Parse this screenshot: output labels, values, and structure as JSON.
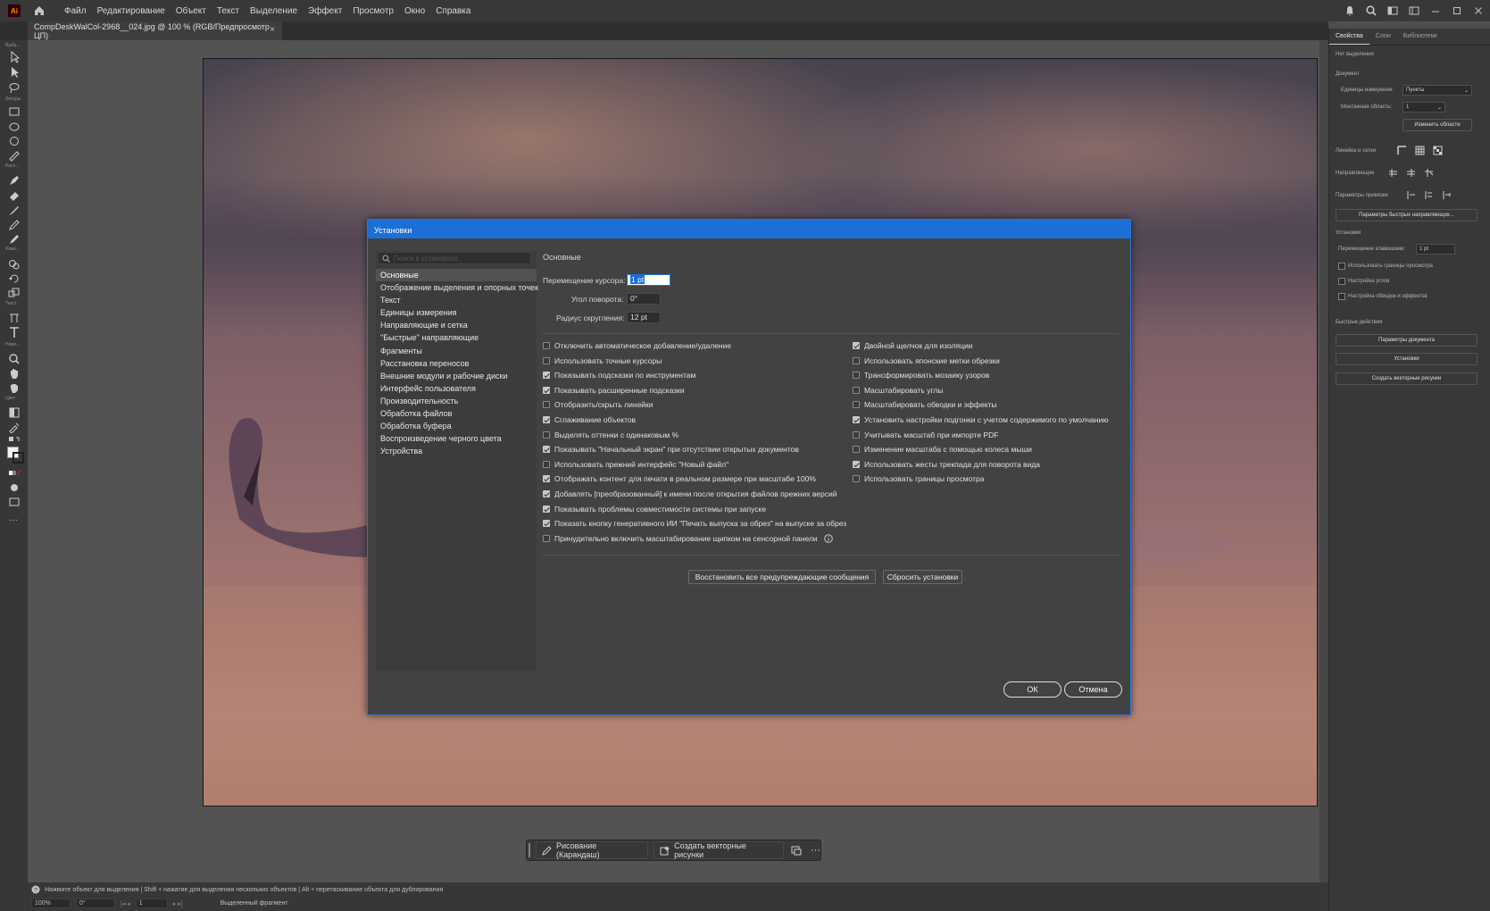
{
  "app": {
    "logo_text": "Ai",
    "menu": [
      "Файл",
      "Редактирование",
      "Объект",
      "Текст",
      "Выделение",
      "Эффект",
      "Просмотр",
      "Окно",
      "Справка"
    ]
  },
  "document_tab": {
    "title": "CompDeskWalCol-2968__024.jpg @ 100 % (RGB/Предпросмотр ЦП)",
    "close": "×"
  },
  "toolbar_labels": [
    "Выбр...",
    "Фигуры",
    "Рисо...",
    "Изме...",
    "Текст",
    "Нави...",
    "Цвет"
  ],
  "floating_bar": {
    "draw_label": "Рисование (Карандаш)",
    "vectorize_label": "Создать векторные рисунки",
    "more": "···"
  },
  "status": {
    "hint": "Нажмите объект для выделения | Shift + нажатие для выделения нескольких объектов | Alt + перетаскивание объекта для дублирования",
    "zoom": "100%",
    "rotation": "0°",
    "artboard_num": "1",
    "mode": "Выделенный фрагмент"
  },
  "right_panel": {
    "tabs": [
      "Свойства",
      "Слои",
      "Библиотеки"
    ],
    "no_selection": "Нет выделения",
    "document_label": "Документ",
    "units_label": "Единицы измерения:",
    "units_value": "Пункты",
    "artboard_label": "Монтажная область:",
    "artboard_value": "1",
    "edit_artboards": "Изменить области",
    "rulers_grids": "Линейка и сетки",
    "guides": "Направляющие",
    "snap_options": "Параметры привязки",
    "smart_guides_btn": "Параметры быстрых направляющих...",
    "prefs_label": "Установки",
    "keyboard_increment_label": "Перемещение клавишами:",
    "keyboard_increment_value": "1 pt",
    "check_preview_bounds": "Использовать границы просмотра",
    "check_corners": "Настройка углов",
    "check_strokes": "Настройка обводок и эффектов",
    "quick_actions": "Быстрые действия",
    "doc_setup_btn": "Параметры документа",
    "prefs_btn": "Установки",
    "vectorize_btn": "Создать векторные рисунки"
  },
  "dialog": {
    "title": "Установки",
    "search_placeholder": "Поиск в установках",
    "nav": [
      "Основные",
      "Отображение выделения и опорных точек",
      "Текст",
      "Единицы измерения",
      "Направляющие и сетка",
      "\"Быстрые\" направляющие",
      "Фрагменты",
      "Расстановка переносов",
      "Внешние модули и рабочие диски",
      "Интерфейс пользователя",
      "Производительность",
      "Обработка файлов",
      "Обработка буфера",
      "Воспроизведение черного цвета",
      "Устройства"
    ],
    "section_title": "Основные",
    "keyboard_increment_label": "Перемещение курсора:",
    "keyboard_increment_value": "1 pt",
    "constrain_angle_label": "Угол поворота:",
    "constrain_angle_value": "0°",
    "corner_radius_label": "Радиус скругления:",
    "corner_radius_value": "12 pt",
    "left_checks": [
      {
        "label": "Отключить автоматическое добавление/удаление",
        "checked": false
      },
      {
        "label": "Использовать точные курсоры",
        "checked": false
      },
      {
        "label": "Показывать подсказки по инструментам",
        "checked": true
      },
      {
        "label": "Показывать расширенные подсказки",
        "checked": true
      },
      {
        "label": "Отобразить/скрыть линейки",
        "checked": false
      },
      {
        "label": "Сглаживание объектов",
        "checked": true
      },
      {
        "label": "Выделять оттенки с одинаковым %",
        "checked": false
      },
      {
        "label": "Показывать \"Начальный экран\" при отсутствии открытых документов",
        "checked": true
      },
      {
        "label": "Использовать прежний интерфейс \"Новый файл\"",
        "checked": false
      },
      {
        "label": "Отображать контент для печати в реальном размере при масштабе 100%",
        "checked": true
      },
      {
        "label": "Добавлять [преобразованный] к имени после открытия файлов прежних версий",
        "checked": true
      },
      {
        "label": "Показывать проблемы совместимости системы при запуске",
        "checked": true
      },
      {
        "label": "Показать кнопку генеративного ИИ \"Печать выпуска за обрез\" на выпуске за обрез",
        "checked": true
      },
      {
        "label": "Принудительно включить масштабирование щипком на сенсорной панели",
        "checked": false
      }
    ],
    "right_checks": [
      {
        "label": "Двойной щелчок для изоляции",
        "checked": true
      },
      {
        "label": "Использовать японские метки обрезки",
        "checked": false
      },
      {
        "label": "Трансформировать мозаику узоров",
        "checked": false
      },
      {
        "label": "Масштабировать углы",
        "checked": false
      },
      {
        "label": "Масштабировать обводки и эффекты",
        "checked": false
      },
      {
        "label": "Установить настройки подгонки с учетом содержимого по умолчанию",
        "checked": true
      },
      {
        "label": "Учитывать масштаб при импорте PDF",
        "checked": false
      },
      {
        "label": "Изменение масштаба с помощью колеса мыши",
        "checked": false
      },
      {
        "label": "Использовать жесты трекпада для поворота вида",
        "checked": true
      },
      {
        "label": "Использовать границы просмотра",
        "checked": false
      }
    ],
    "reset_warnings_btn": "Восстановить все предупреждающие сообщения",
    "reset_prefs_btn": "Сбросить установки",
    "ok_btn": "ОК",
    "cancel_btn": "Отмена"
  }
}
